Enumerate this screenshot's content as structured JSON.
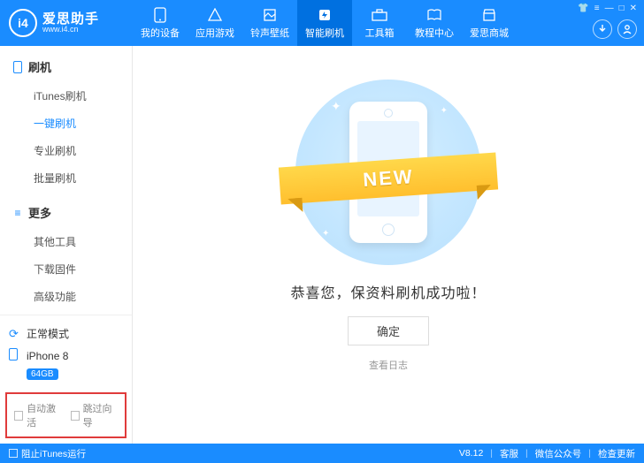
{
  "brand": {
    "name": "爱思助手",
    "url": "www.i4.cn",
    "logo_text": "i4"
  },
  "nav": [
    {
      "label": "我的设备",
      "icon": "phone"
    },
    {
      "label": "应用游戏",
      "icon": "apps"
    },
    {
      "label": "铃声壁纸",
      "icon": "media"
    },
    {
      "label": "智能刷机",
      "icon": "flash",
      "active": true
    },
    {
      "label": "工具箱",
      "icon": "tools"
    },
    {
      "label": "教程中心",
      "icon": "book"
    },
    {
      "label": "爱思商城",
      "icon": "store"
    }
  ],
  "header_actions": {
    "download": "↓",
    "user": "👤"
  },
  "sidebar": {
    "groups": [
      {
        "title": "刷机",
        "icon": "phone-outline",
        "items": [
          "iTunes刷机",
          "一键刷机",
          "专业刷机",
          "批量刷机"
        ],
        "active_index": 1
      },
      {
        "title": "更多",
        "icon": "menu",
        "items": [
          "其他工具",
          "下载固件",
          "高级功能"
        ]
      }
    ],
    "status": {
      "mode": "正常模式",
      "device": "iPhone 8",
      "storage": "64GB"
    },
    "bottom_checks": [
      "自动激活",
      "跳过向导"
    ]
  },
  "main": {
    "ribbon": "NEW",
    "success": "恭喜您，保资料刷机成功啦！",
    "ok": "确定",
    "view_log": "查看日志"
  },
  "footer": {
    "block_itunes": "阻止iTunes运行",
    "version": "V8.12",
    "links": [
      "客服",
      "微信公众号",
      "检查更新"
    ]
  }
}
